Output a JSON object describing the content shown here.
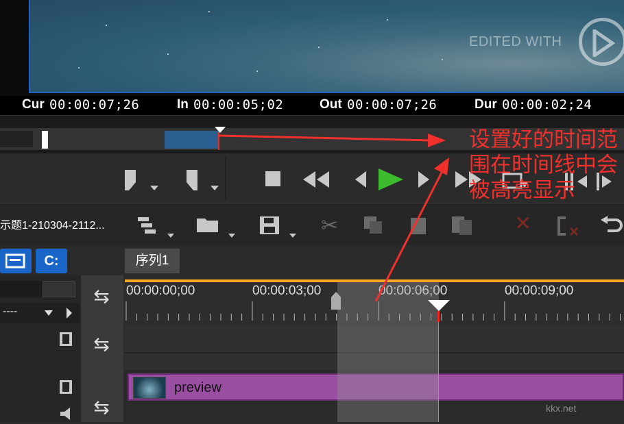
{
  "timecodes": {
    "cur_label": "Cur",
    "cur_value": "00:00:07;26",
    "in_label": "In",
    "in_value": "00:00:05;02",
    "out_label": "Out",
    "out_value": "00:00:07;26",
    "dur_label": "Dur",
    "dur_value": "00:00:02;24"
  },
  "preview": {
    "watermark": "EDITED WITH"
  },
  "toolbar": {
    "project_title": "示题1-210304-2112..."
  },
  "tabs": {
    "sequence_tab": "序列1",
    "btn_a": "",
    "btn_c": "C:"
  },
  "left_panel": {
    "dropdown_value": "----"
  },
  "timeline": {
    "ruler_labels": [
      "00:00:00;00",
      "00:00:03;00",
      "00:00:06;00",
      "00:00:09;00"
    ]
  },
  "clip": {
    "label": "preview"
  },
  "annotation": {
    "text": "设置好的时间范围在时间线中会被高亮显示"
  },
  "watermark_corner": "kkx.net",
  "colors": {
    "accent_blue": "#1a65c8",
    "clip_purple": "#9b4fa3",
    "orange_line": "#f5a623",
    "annotation_red": "#f0302c",
    "play_green": "#3dbb2e"
  }
}
